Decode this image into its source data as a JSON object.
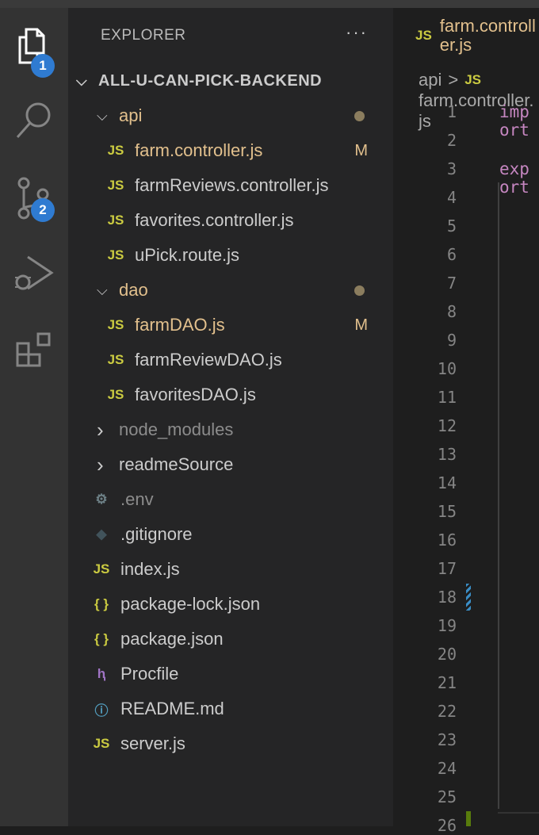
{
  "activity_bar": {
    "explorer_badge": "1",
    "scm_badge": "2"
  },
  "sidebar": {
    "title": "EXPLORER",
    "more": "···",
    "root": "ALL-U-CAN-PICK-BACKEND",
    "items": [
      {
        "label": "api",
        "type": "folder",
        "open": true,
        "depth": 1,
        "dot": true
      },
      {
        "label": "farm.controller.js",
        "type": "js",
        "depth": 2,
        "status": "M"
      },
      {
        "label": "farmReviews.controller.js",
        "type": "js",
        "depth": 2
      },
      {
        "label": "favorites.controller.js",
        "type": "js",
        "depth": 2
      },
      {
        "label": "uPick.route.js",
        "type": "js",
        "depth": 2
      },
      {
        "label": "dao",
        "type": "folder",
        "open": true,
        "depth": 1,
        "dot": true
      },
      {
        "label": "farmDAO.js",
        "type": "js",
        "depth": 2,
        "status": "M"
      },
      {
        "label": "farmReviewDAO.js",
        "type": "js",
        "depth": 2
      },
      {
        "label": "favoritesDAO.js",
        "type": "js",
        "depth": 2
      },
      {
        "label": "node_modules",
        "type": "folder",
        "open": false,
        "depth": 1,
        "dim": true
      },
      {
        "label": "readmeSource",
        "type": "folder",
        "open": false,
        "depth": 1
      },
      {
        "label": ".env",
        "type": "gear",
        "depth": 1,
        "dim": true
      },
      {
        "label": ".gitignore",
        "type": "git",
        "depth": 1
      },
      {
        "label": "index.js",
        "type": "js",
        "depth": 1
      },
      {
        "label": "package-lock.json",
        "type": "json",
        "depth": 1
      },
      {
        "label": "package.json",
        "type": "json",
        "depth": 1
      },
      {
        "label": "Procfile",
        "type": "heroku",
        "depth": 1
      },
      {
        "label": "README.md",
        "type": "info",
        "depth": 1
      },
      {
        "label": "server.js",
        "type": "js",
        "depth": 1
      }
    ]
  },
  "editor": {
    "tab": {
      "icon": "JS",
      "label": "farm.controller.js"
    },
    "breadcrumb": {
      "folder": "api",
      "sep": ">",
      "icon": "JS",
      "file": "farm.controller.js"
    },
    "line_numbers": [
      "1",
      "2",
      "3",
      "4",
      "5",
      "6",
      "7",
      "8",
      "9",
      "10",
      "11",
      "12",
      "13",
      "14",
      "15",
      "16",
      "17",
      "18",
      "19",
      "20",
      "21",
      "22",
      "23",
      "24",
      "25",
      "26"
    ],
    "code": {
      "line1": "import",
      "line3": "export"
    }
  },
  "colors": {
    "modified": "#e2c08d",
    "js": "#cbcb41",
    "badge": "#2f7bd1",
    "keyword": "#c586c0"
  }
}
